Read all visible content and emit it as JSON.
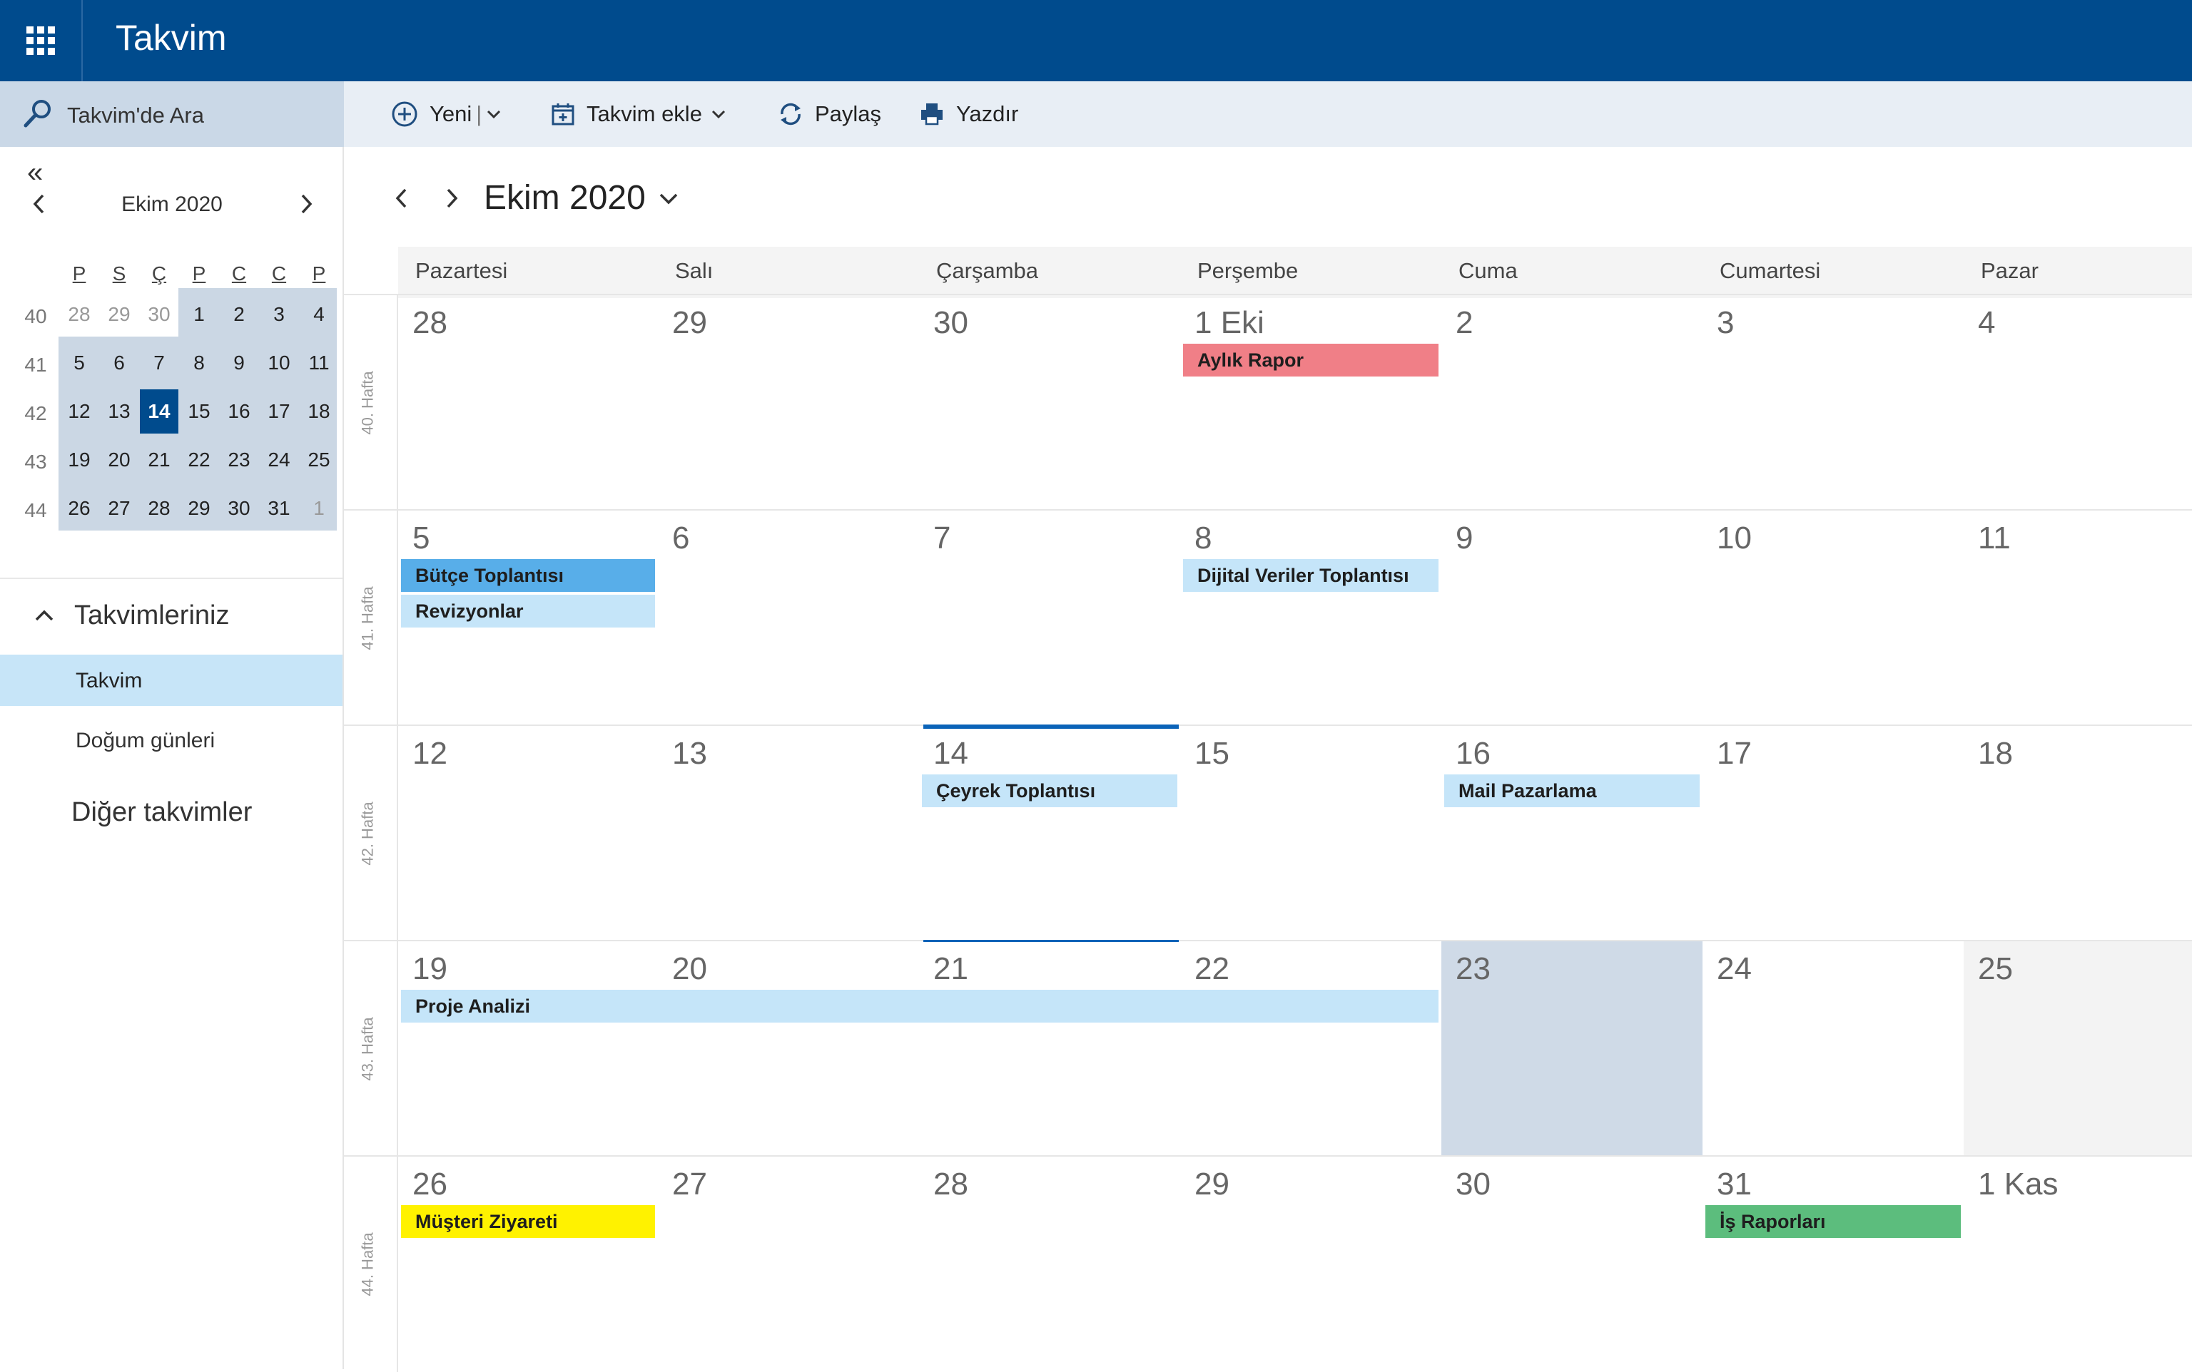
{
  "app": {
    "title": "Takvim"
  },
  "search": {
    "placeholder": "Takvim'de Ara"
  },
  "toolbar": {
    "new_label": "Yeni",
    "add_calendar_label": "Takvim ekle",
    "share_label": "Paylaş",
    "print_label": "Yazdır"
  },
  "mini_calendar": {
    "title": "Ekim 2020",
    "day_headers": [
      "P",
      "S",
      "Ç",
      "P",
      "C",
      "C",
      "P"
    ],
    "week_numbers": [
      "40",
      "41",
      "42",
      "43",
      "44"
    ],
    "weeks": [
      [
        "28",
        "29",
        "30",
        "1",
        "2",
        "3",
        "4"
      ],
      [
        "5",
        "6",
        "7",
        "8",
        "9",
        "10",
        "11"
      ],
      [
        "12",
        "13",
        "14",
        "15",
        "16",
        "17",
        "18"
      ],
      [
        "19",
        "20",
        "21",
        "22",
        "23",
        "24",
        "25"
      ],
      [
        "26",
        "27",
        "28",
        "29",
        "30",
        "31",
        "1"
      ]
    ],
    "selected": "14"
  },
  "sidebar": {
    "section_title": "Takvimleriniz",
    "calendars": [
      "Takvim",
      "Doğum günleri"
    ],
    "other_calendars": "Diğer takvimler"
  },
  "main": {
    "month_title": "Ekim 2020",
    "day_names": [
      "Pazartesi",
      "Salı",
      "Çarşamba",
      "Perşembe",
      "Cuma",
      "Cumartesi",
      "Pazar"
    ],
    "weeks": [
      {
        "label": "40. Hafta",
        "days": [
          "28",
          "29",
          "30",
          "1 Eki",
          "2",
          "3",
          "4"
        ]
      },
      {
        "label": "41. Hafta",
        "days": [
          "5",
          "6",
          "7",
          "8",
          "9",
          "10",
          "11"
        ]
      },
      {
        "label": "42. Hafta",
        "days": [
          "12",
          "13",
          "14",
          "15",
          "16",
          "17",
          "18"
        ]
      },
      {
        "label": "43. Hafta",
        "days": [
          "19",
          "20",
          "21",
          "22",
          "23",
          "24",
          "25"
        ]
      },
      {
        "label": "44. Hafta",
        "days": [
          "26",
          "27",
          "28",
          "29",
          "30",
          "31",
          "1 Kas"
        ]
      }
    ],
    "events": [
      {
        "title": "Aylık Rapor",
        "week": 0,
        "day": 3,
        "span": 1,
        "slot": 0,
        "color": "#f07f87"
      },
      {
        "title": "Bütçe Toplantısı",
        "week": 1,
        "day": 0,
        "span": 1,
        "slot": 0,
        "color": "#58aee9"
      },
      {
        "title": "Revizyonlar",
        "week": 1,
        "day": 0,
        "span": 1,
        "slot": 1,
        "color": "#c5e5f9"
      },
      {
        "title": "Dijital Veriler Toplantısı",
        "week": 1,
        "day": 3,
        "span": 1,
        "slot": 0,
        "color": "#c5e5f9"
      },
      {
        "title": "Çeyrek Toplantısı",
        "week": 2,
        "day": 2,
        "span": 1,
        "slot": 0,
        "color": "#c5e5f9"
      },
      {
        "title": "Mail Pazarlama",
        "week": 2,
        "day": 4,
        "span": 1,
        "slot": 0,
        "color": "#c5e5f9"
      },
      {
        "title": "Proje Analizi",
        "week": 3,
        "day": 0,
        "span": 4,
        "slot": 0,
        "color": "#c5e5f9"
      },
      {
        "title": "Müşteri Ziyareti",
        "week": 4,
        "day": 0,
        "span": 1,
        "slot": 0,
        "color": "#fff200"
      },
      {
        "title": "İş Raporları",
        "week": 4,
        "day": 5,
        "span": 1,
        "slot": 0,
        "color": "#5cbd7d"
      }
    ],
    "highlight": {
      "selected_bg": "#cfdae7",
      "weekend_bg": "#f3f3f3"
    }
  }
}
